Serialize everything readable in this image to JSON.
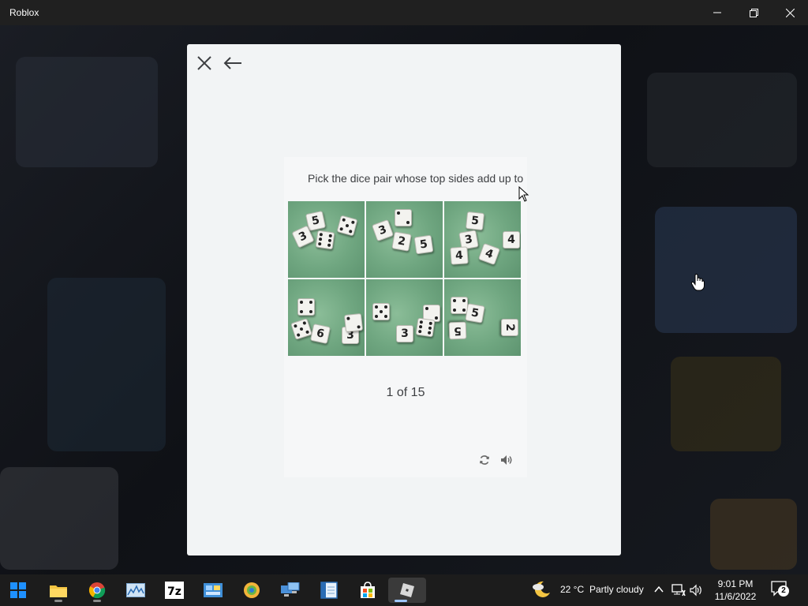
{
  "window": {
    "title": "Roblox",
    "minimize_icon": "minimize-icon",
    "restore_icon": "restore-icon",
    "close_icon": "close-icon"
  },
  "modal": {
    "close_icon": "close-x-icon",
    "back_icon": "arrow-left-icon",
    "background": "#f2f4f5"
  },
  "captcha": {
    "instruction": "Pick the dice pair whose top sides add up to",
    "progress": "1 of 15",
    "reload_icon": "reload-icon",
    "audio_icon": "speaker-icon",
    "tiles": [
      {
        "label": "tile 1"
      },
      {
        "label": "tile 2"
      },
      {
        "label": "tile 3"
      },
      {
        "label": "tile 4"
      },
      {
        "label": "tile 5"
      },
      {
        "label": "tile 6"
      }
    ]
  },
  "taskbar": {
    "apps": [
      "windows-start-icon",
      "file-explorer-icon",
      "chrome-icon",
      "performance-monitor-icon",
      "7zip-icon",
      "control-panel-icon",
      "web-browser-icon",
      "remote-desktop-icon",
      "notepad-icon",
      "microsoft-store-icon",
      "roblox-icon"
    ],
    "weather": {
      "temperature": "22 °C",
      "condition": "Partly cloudy",
      "icon": "moon-cloud-icon"
    },
    "clock": {
      "time": "9:01 PM",
      "date": "11/6/2022"
    },
    "notifications": {
      "count": "2"
    }
  },
  "colors": {
    "titlebar": "#202020",
    "taskbar": "#1c1c1c",
    "text_dark": "#3d3f42",
    "tile_green": "#6fa680"
  }
}
